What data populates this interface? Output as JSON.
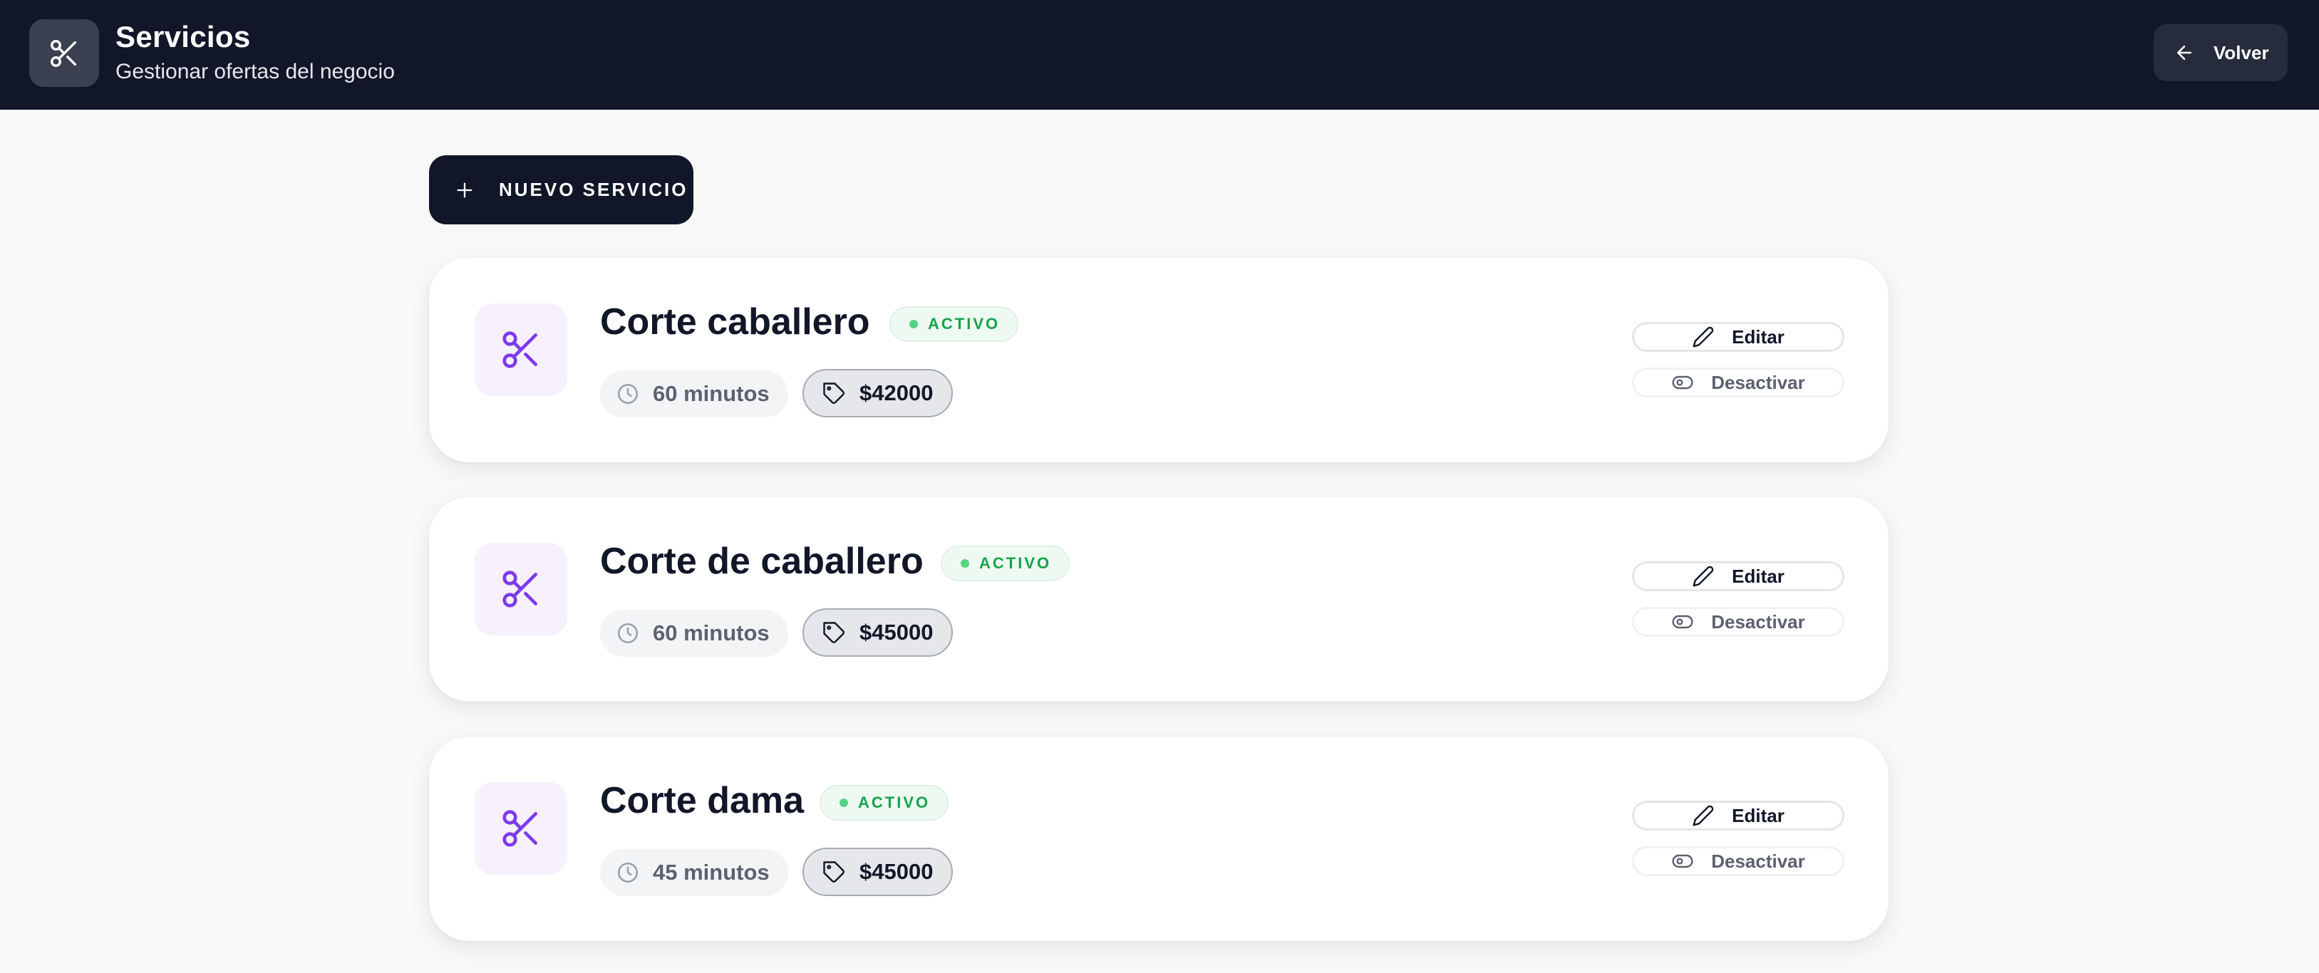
{
  "header": {
    "title": "Servicios",
    "subtitle": "Gestionar ofertas del negocio",
    "back_label": "Volver"
  },
  "actions": {
    "new_service_label": "NUEVO SERVICIO"
  },
  "services": [
    {
      "name": "Corte caballero",
      "status": "ACTIVO",
      "duration": "60 minutos",
      "price": "$42000",
      "edit_label": "Editar",
      "toggle_label": "Desactivar"
    },
    {
      "name": "Corte de caballero",
      "status": "ACTIVO",
      "duration": "60 minutos",
      "price": "$45000",
      "edit_label": "Editar",
      "toggle_label": "Desactivar"
    },
    {
      "name": "Corte dama",
      "status": "ACTIVO",
      "duration": "45 minutos",
      "price": "$45000",
      "edit_label": "Editar",
      "toggle_label": "Desactivar"
    }
  ],
  "icons": {
    "app": "scissors-icon",
    "back": "arrow-left-icon",
    "new": "plus-icon",
    "service": "scissors-icon",
    "duration": "clock-icon",
    "price": "tag-icon",
    "edit": "pencil-icon",
    "toggle": "eye-icon"
  },
  "colors": {
    "header_bg": "#111729",
    "accent_purple": "#7c3aed",
    "status_green": "#16a34a",
    "page_bg": "#f8f8f9"
  }
}
